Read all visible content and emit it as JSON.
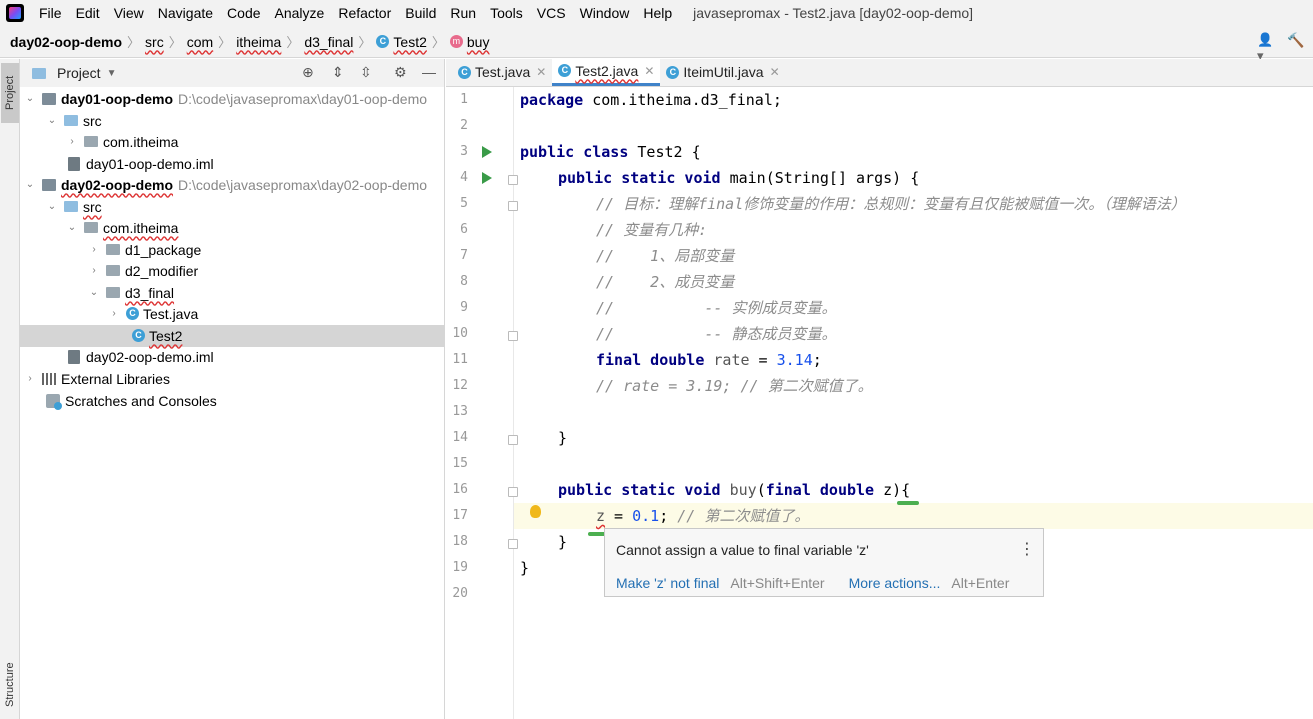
{
  "menu": {
    "items": [
      "File",
      "Edit",
      "View",
      "Navigate",
      "Code",
      "Analyze",
      "Refactor",
      "Build",
      "Run",
      "Tools",
      "VCS",
      "Window",
      "Help"
    ],
    "window_title": "javasepromax - Test2.java [day02-oop-demo]"
  },
  "breadcrumb": {
    "root": "day02-oop-demo",
    "items": [
      "src",
      "com",
      "itheima",
      "d3_final",
      "Test2",
      "buy"
    ]
  },
  "side_tabs": {
    "project": "Project",
    "structure": "Structure"
  },
  "project": {
    "title": "Project",
    "tree": [
      {
        "label": "day01-oop-demo",
        "path": "D:\\code\\javasepromax\\day01-oop-demo"
      },
      {
        "label": "src"
      },
      {
        "label": "com.itheima"
      },
      {
        "label": "day01-oop-demo.iml"
      },
      {
        "label": "day02-oop-demo",
        "path": "D:\\code\\javasepromax\\day02-oop-demo"
      },
      {
        "label": "src"
      },
      {
        "label": "com.itheima"
      },
      {
        "label": "d1_package"
      },
      {
        "label": "d2_modifier"
      },
      {
        "label": "d3_final"
      },
      {
        "label": "Test.java"
      },
      {
        "label": "Test2"
      },
      {
        "label": "day02-oop-demo.iml"
      },
      {
        "label": "External Libraries"
      },
      {
        "label": "Scratches and Consoles"
      }
    ]
  },
  "tabs": [
    {
      "label": "Test.java"
    },
    {
      "label": "Test2.java"
    },
    {
      "label": "IteimUtil.java"
    }
  ],
  "code": {
    "line_numbers": [
      "1",
      "2",
      "3",
      "4",
      "5",
      "6",
      "7",
      "8",
      "9",
      "10",
      "11",
      "12",
      "13",
      "14",
      "15",
      "16",
      "17",
      "18",
      "19",
      "20"
    ],
    "l1_kw": "package",
    "l1_rest": " com.itheima.d3_final;",
    "l3_kw": "public class",
    "l3_rest": " Test2 {",
    "l4_kw": "public static void",
    "l4_rest": " main(String[] args) {",
    "l5": "// 目标：理解final修饰变量的作用：总规则：变量有且仅能被赋值一次。（理解语法）",
    "l6": "// 变量有几种:",
    "l7": "//    1、局部变量",
    "l8": "//    2、成员变量",
    "l9": "//          -- 实例成员变量。",
    "l10": "//          -- 静态成员变量。",
    "l11_kw": "final double",
    "l11_var": " rate",
    "l11_eq": " = ",
    "l11_num": "3.14",
    "l11_end": ";",
    "l12": "// rate = 3.19; // 第二次赋值了。",
    "l14": "}",
    "l16_kw": "public static void",
    "l16_name": " buy",
    "l16_paren": "(",
    "l16_kw2": "final double",
    "l16_param": " z",
    "l16_end": "){",
    "l17_var": "z",
    "l17_eq": " = ",
    "l17_num": "0.1",
    "l17_semi": "; ",
    "l17_cm": "// 第二次赋值了。",
    "l18": "}",
    "l19": "}"
  },
  "tooltip": {
    "message": "Cannot assign a value to final variable 'z'",
    "action1": "Make 'z' not final",
    "action1_key": "Alt+Shift+Enter",
    "action2": "More actions...",
    "action2_key": "Alt+Enter"
  }
}
